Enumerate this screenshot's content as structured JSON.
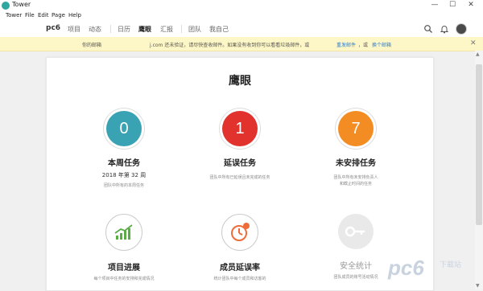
{
  "window": {
    "title": "Tower",
    "min": "—",
    "max": "☐",
    "close": "✕"
  },
  "menu": [
    "Tower",
    "File",
    "Edit",
    "Page",
    "Help"
  ],
  "nav": {
    "brand": "pc6",
    "items": [
      "项目",
      "动态",
      "日历",
      "鹰眼",
      "汇报",
      "团队",
      "我自己"
    ],
    "active": "鹰眼"
  },
  "notice": {
    "left": "你的邮箱",
    "mid": "j.com 还未验证，请尽快查收邮件。如果没有收到你可以看看垃圾邮件，或",
    "resend": "重发邮件",
    "or": "，或",
    "change": "换个邮箱",
    "close": "✕"
  },
  "page_title": "鹰眼",
  "tiles": [
    {
      "value": "0",
      "title": "本周任务",
      "sub": "2018 年第 32 周",
      "desc": "团队中所有的本周任务",
      "color": "#3aa3b3"
    },
    {
      "value": "1",
      "title": "延误任务",
      "sub": "",
      "desc": "团队中所有已延误且未完成的任务",
      "color": "#e2322e"
    },
    {
      "value": "7",
      "title": "未安排任务",
      "sub": "",
      "desc": "团队中所有未安排负责人\n和截止时间的任务",
      "color": "#f28c23"
    },
    {
      "title": "项目进展",
      "desc": "每个项目中任务的安排和完成情况",
      "icon": "progress-chart-icon",
      "color": "#5aac44"
    },
    {
      "title": "成员延误率",
      "desc": "统计团队中每个成员和访客的",
      "icon": "clock-alert-icon",
      "color": "#ef6c3a"
    },
    {
      "title": "安全统计",
      "desc": "团队成员的账号活动情况",
      "icon": "key-icon",
      "color": "#cfcfcf"
    }
  ],
  "watermark": {
    "logo": "pc6",
    "text": "下载站"
  }
}
